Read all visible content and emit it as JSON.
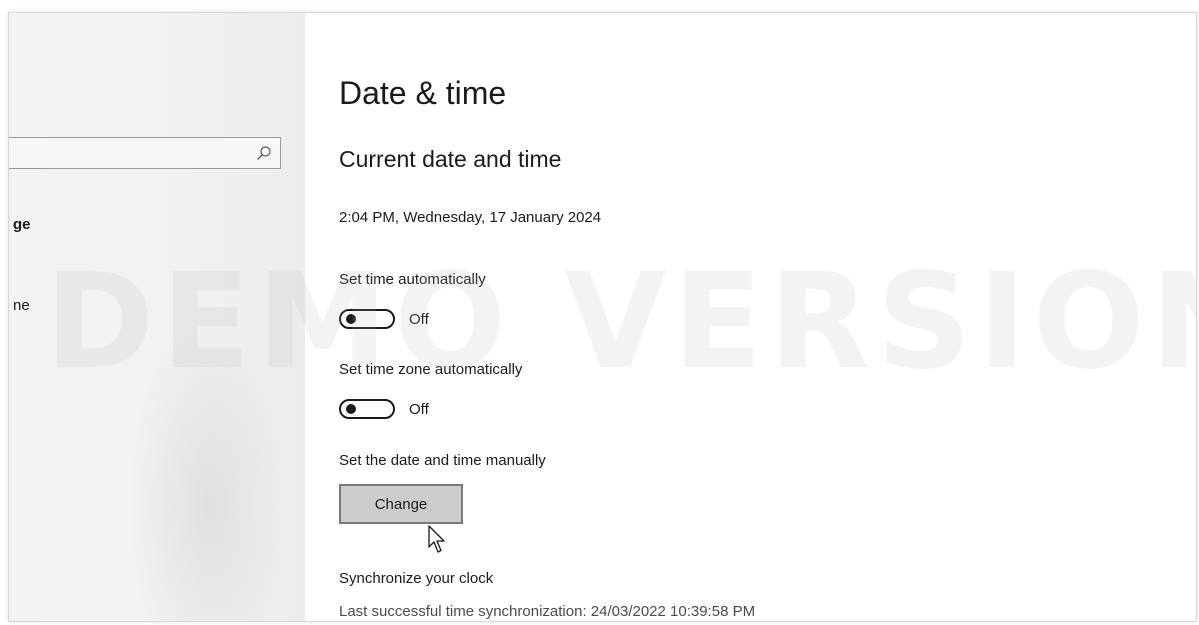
{
  "watermark": "DEMO VERSION",
  "sidebar": {
    "search": {
      "placeholder": "",
      "value": ""
    },
    "items": [
      {
        "label": "ge"
      },
      {
        "label": "ne"
      }
    ]
  },
  "main": {
    "title": "Date & time",
    "section_title": "Current date and time",
    "current_datetime": "2:04 PM, Wednesday, 17 January 2024",
    "set_time_auto": {
      "label": "Set time automatically",
      "state": "Off"
    },
    "set_tz_auto": {
      "label": "Set time zone automatically",
      "state": "Off"
    },
    "manual": {
      "label": "Set the date and time manually",
      "button": "Change"
    },
    "sync": {
      "title": "Synchronize your clock",
      "last": "Last successful time synchronization: 24/03/2022 10:39:58 PM"
    }
  },
  "icons": [
    "search-icon",
    "mouse-cursor-icon"
  ],
  "colors": {
    "sidebar_bg": "#f1f1f1",
    "button_bg": "#cccccc",
    "text": "#1a1a1a"
  }
}
